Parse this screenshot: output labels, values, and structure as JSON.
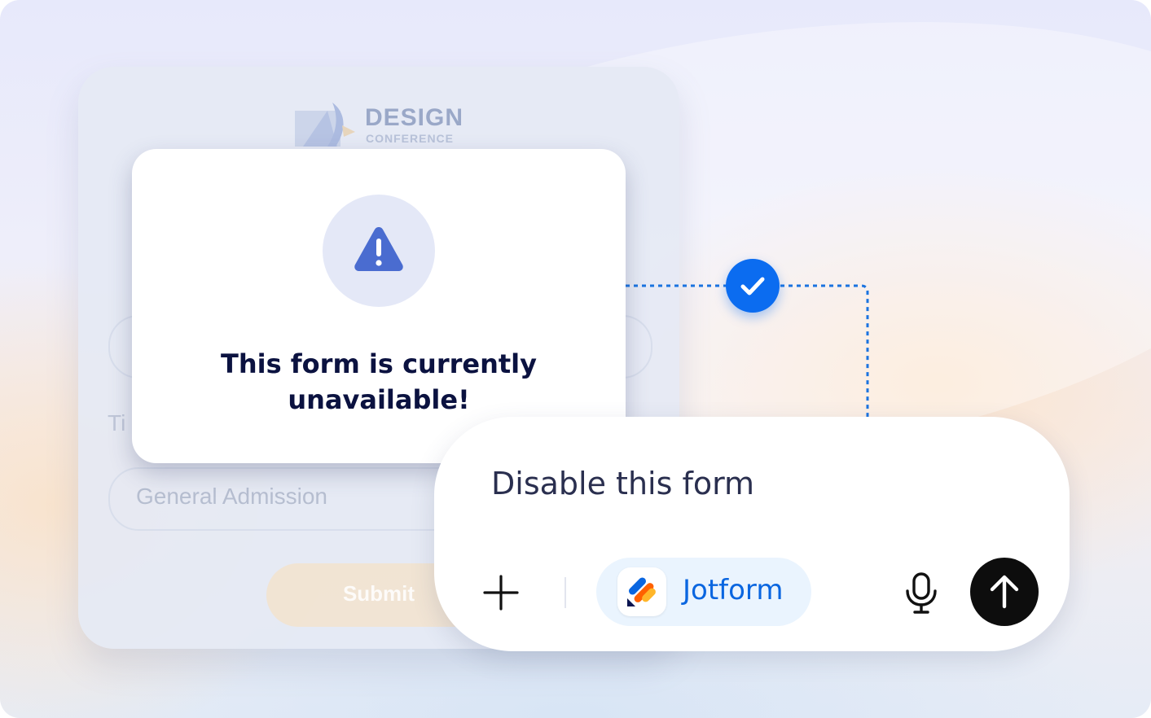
{
  "background_form": {
    "logo_title": "DESIGN",
    "logo_subtitle": "CONFERENCE",
    "field_label": "Ti",
    "select_value": "General Admission",
    "submit_label": "Submit"
  },
  "modal": {
    "icon": "warning-triangle-icon",
    "title_line1": "This form is currently",
    "title_line2": "unavailable!"
  },
  "connector": {
    "status_icon": "check-icon",
    "accent_color": "#0b6cf0"
  },
  "prompt_card": {
    "text": "Disable this form",
    "add_icon": "plus-icon",
    "chip_label": "Jotform",
    "mic_icon": "microphone-icon",
    "send_icon": "arrow-up-icon"
  },
  "colors": {
    "warning": "#4a6cd0",
    "title": "#0b1240",
    "chip_bg": "#eaf4fe",
    "chip_text": "#0a66e0",
    "send_bg": "#0d0d0d"
  }
}
